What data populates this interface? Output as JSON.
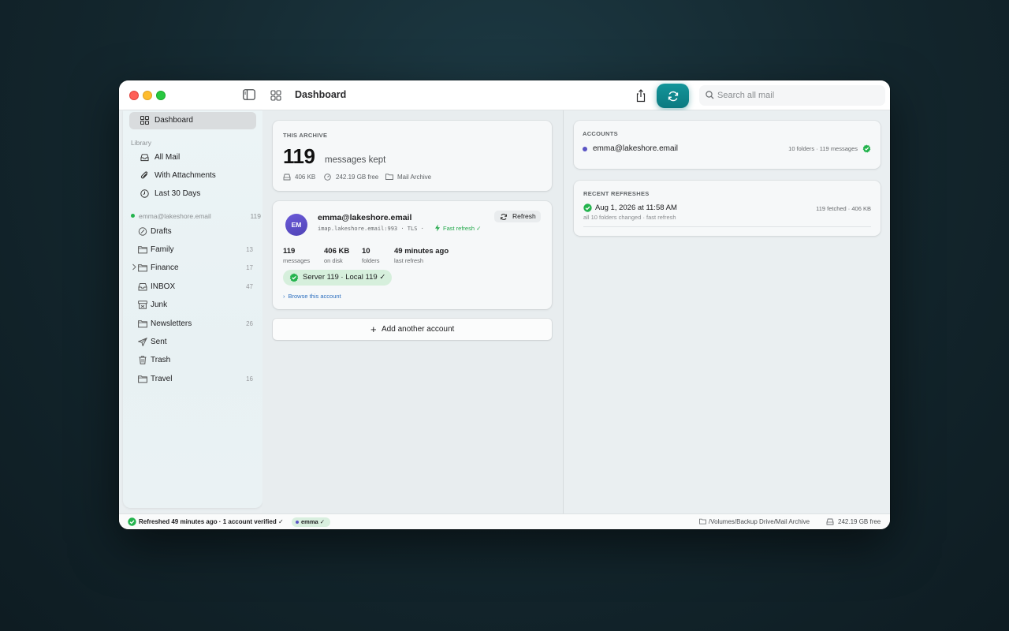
{
  "window": {
    "title": "Dashboard",
    "search_placeholder": "Search all mail"
  },
  "sidebar": {
    "dashboard_label": "Dashboard",
    "library_label": "Library",
    "library_items": [
      {
        "label": "All Mail",
        "icon": "tray-icon"
      },
      {
        "label": "With Attachments",
        "icon": "paperclip-icon"
      },
      {
        "label": "Last 30 Days",
        "icon": "clock-icon"
      }
    ],
    "account": {
      "email": "emma@lakeshore.email",
      "count": "119",
      "status_color": "#23b34d"
    },
    "folders": [
      {
        "label": "Drafts",
        "count": "",
        "icon": "drafts-icon"
      },
      {
        "label": "Family",
        "count": "13",
        "icon": "folder-icon"
      },
      {
        "label": "Finance",
        "count": "17",
        "icon": "folder-icon",
        "expandable": true
      },
      {
        "label": "INBOX",
        "count": "47",
        "icon": "inbox-icon"
      },
      {
        "label": "Junk",
        "count": "",
        "icon": "junk-icon"
      },
      {
        "label": "Newsletters",
        "count": "26",
        "icon": "folder-icon"
      },
      {
        "label": "Sent",
        "count": "",
        "icon": "paper-plane-icon"
      },
      {
        "label": "Trash",
        "count": "",
        "icon": "trash-icon"
      },
      {
        "label": "Travel",
        "count": "16",
        "icon": "folder-icon"
      }
    ]
  },
  "archive": {
    "caption": "THIS ARCHIVE",
    "count": "119",
    "count_suffix": "messages kept",
    "size": "406 KB",
    "free": "242.19 GB free",
    "name": "Mail Archive"
  },
  "account_card": {
    "initials": "EM",
    "email": "emma@lakeshore.email",
    "server": "imap.lakeshore.email:993 · TLS ·",
    "fast_refresh": "Fast refresh ✓",
    "refresh_label": "Refresh",
    "stats": [
      {
        "value": "119",
        "label": "messages"
      },
      {
        "value": "406 KB",
        "label": "on disk"
      },
      {
        "value": "10",
        "label": "folders"
      },
      {
        "value": "49 minutes ago",
        "label": "last refresh"
      }
    ],
    "verify": "Server 119 · Local 119 ✓",
    "browse": "Browse this account"
  },
  "add_account_label": "Add another account",
  "accounts_panel": {
    "caption": "ACCOUNTS",
    "email": "emma@lakeshore.email",
    "info": "10 folders · 119 messages"
  },
  "refresh_panel": {
    "caption": "RECENT REFRESHES",
    "date": "Aug 1, 2026 at 11:58 AM",
    "sub": "all 10 folders changed · fast refresh",
    "right": "119 fetched · 406 KB"
  },
  "statusbar": {
    "text": "Refreshed 49 minutes ago · 1 account verified ✓",
    "pill": "emma ✓",
    "path": "/Volumes/Backup Drive/Mail Archive",
    "free": "242.19 GB free"
  },
  "colors": {
    "accent": "#0f8a90",
    "success": "#23b34d",
    "account_dot": "#5b55c4",
    "link": "#2d6fbf"
  }
}
